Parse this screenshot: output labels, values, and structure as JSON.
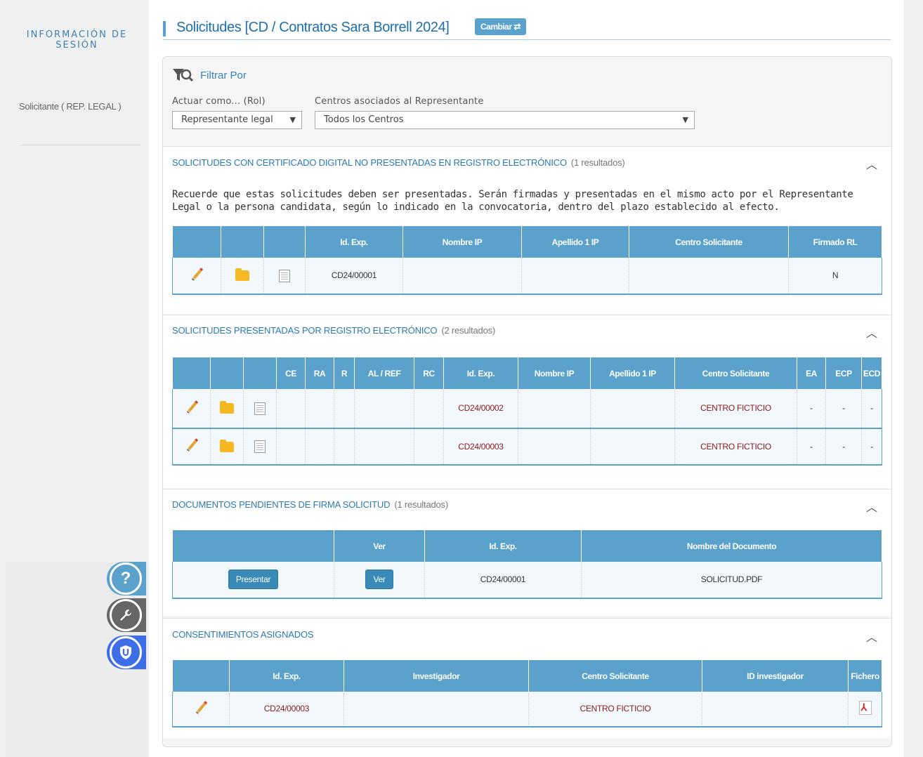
{
  "sidebar": {
    "session_title": "INFORMACIÓN DE SESIÓN",
    "user_role": "Solicitante ( REP. LEGAL )"
  },
  "header": {
    "title": "Solicitudes [CD / Contratos Sara Borrell 2024]",
    "change_button": "Cambiar ⇄"
  },
  "filter": {
    "label": "Filtrar Por",
    "role_label": "Actuar como... (Rol)",
    "role_value": "Representante legal",
    "centers_label": "Centros asociados al Representante",
    "centers_value": "Todos los Centros"
  },
  "section1": {
    "title": "SOLICITUDES CON CERTIFICADO DIGITAL NO PRESENTADAS EN REGISTRO ELECTRÓNICO",
    "count": "(1 resultados)",
    "notice": "Recuerde que estas solicitudes deben ser presentadas. Serán firmadas y presentadas en el mismo acto por el Representante Legal o la persona candidata, según lo indicado en la convocatoria, dentro del plazo establecido al efecto.",
    "headers": [
      "",
      "",
      "",
      "Id. Exp.",
      "Nombre IP",
      "Apellido 1 IP",
      "Centro Solicitante",
      "Firmado RL"
    ],
    "rows": [
      {
        "id": "CD24/00001",
        "nombre": "",
        "apellido": "",
        "centro": "",
        "firmado": "N"
      }
    ]
  },
  "section2": {
    "title": "SOLICITUDES PRESENTADAS POR REGISTRO ELECTRÓNICO",
    "count": "(2 resultados)",
    "headers": [
      "",
      "",
      "",
      "CE",
      "RA",
      "R",
      "AL / REF",
      "RC",
      "Id. Exp.",
      "Nombre IP",
      "Apellido 1 IP",
      "Centro Solicitante",
      "EA",
      "ECP",
      "ECD"
    ],
    "rows": [
      {
        "id": "CD24/00002",
        "centro": "CENTRO FICTICIO",
        "ea": "-",
        "ecp": "-",
        "ecd": "-"
      },
      {
        "id": "CD24/00003",
        "centro": "CENTRO FICTICIO",
        "ea": "-",
        "ecp": "-",
        "ecd": "-"
      }
    ]
  },
  "section3": {
    "title": "DOCUMENTOS PENDIENTES DE FIRMA SOLICITUD",
    "count": "(1 resultados)",
    "headers": [
      "",
      "Ver",
      "Id. Exp.",
      "Nombre del Documento"
    ],
    "rows": [
      {
        "present_label": "Presentar",
        "ver_label": "Ver",
        "id": "CD24/00001",
        "documento": "SOLICITUD.PDF"
      }
    ]
  },
  "section4": {
    "title": "CONSENTIMIENTOS ASIGNADOS",
    "headers": [
      "",
      "Id. Exp.",
      "Investigador",
      "Centro Solicitante",
      "ID investigador",
      "Fichero"
    ],
    "rows": [
      {
        "id": "CD24/00003",
        "investigador": "",
        "centro": "CENTRO FICTICIO",
        "id_investigador": ""
      }
    ]
  },
  "side_tabs": {
    "help_glyph": "?"
  },
  "colors": {
    "accent": "#5aa2cc",
    "title_blue": "#1f6fad",
    "dark_red": "#8b1a1a"
  }
}
